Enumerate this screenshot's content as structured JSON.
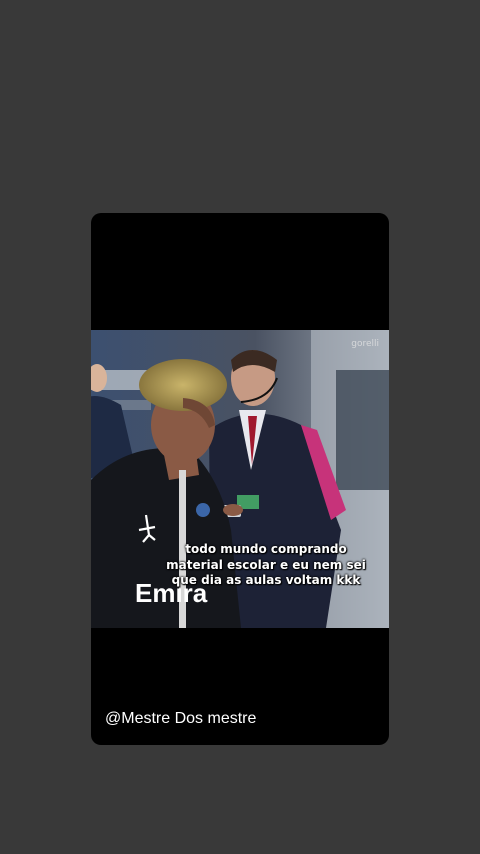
{
  "story": {
    "caption_lines": "todo mundo comprando\nmaterial escolar e eu nem sei\nque dia as aulas voltam kkk",
    "watermark": "gorelli",
    "shirt_text": "Emira",
    "username": "@Mestre Dos mestre"
  },
  "colors": {
    "page_background": "#393939",
    "card_background": "#000000"
  }
}
